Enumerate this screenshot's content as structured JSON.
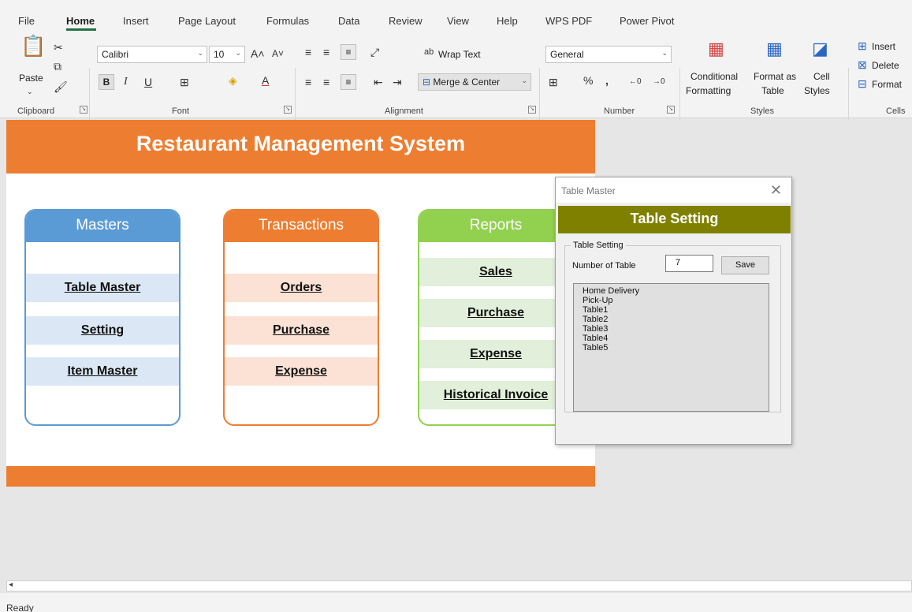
{
  "menu": {
    "tabs": [
      "File",
      "Home",
      "Insert",
      "Page Layout",
      "Formulas",
      "Data",
      "Review",
      "View",
      "Help",
      "WPS PDF",
      "Power Pivot"
    ]
  },
  "ribbon": {
    "clipboard": {
      "paste": "Paste",
      "label": "Clipboard"
    },
    "font": {
      "name": "Calibri",
      "size": "10",
      "label": "Font"
    },
    "alignment": {
      "wrap_text": "Wrap Text",
      "merge_center": "Merge & Center",
      "label": "Alignment"
    },
    "number": {
      "format": "General",
      "label": "Number"
    },
    "styles": {
      "conditional": "Conditional",
      "formatting": "Formatting",
      "format_as": "Format as",
      "table": "Table",
      "cell": "Cell",
      "cell_styles": "Styles",
      "label": "Styles"
    },
    "cells": {
      "insert": "Insert",
      "delete": "Delete",
      "format": "Format",
      "label": "Cells"
    }
  },
  "sheet": {
    "title": "Restaurant Management System",
    "masters": {
      "title": "Masters",
      "items": [
        "Table Master",
        "Setting",
        "Item Master"
      ]
    },
    "transactions": {
      "title": "Transactions",
      "items": [
        "Orders",
        "Purchase",
        "Expense"
      ]
    },
    "reports": {
      "title": "Reports",
      "items": [
        "Sales",
        "Purchase",
        "Expense",
        "Historical Invoice"
      ]
    }
  },
  "dialog": {
    "window_title": "Table Master",
    "header": "Table Setting",
    "frame_label": "Table Setting",
    "number_label": "Number of Table",
    "number_value": "7",
    "save": "Save",
    "list": [
      "Home Delivery",
      "Pick-Up",
      "Table1",
      "Table2",
      "Table3",
      "Table4",
      "Table5"
    ]
  },
  "status": {
    "text": "Ready"
  },
  "colors": {
    "accent_orange": "#ed7d31",
    "masters_blue": "#5b9bd5",
    "reports_green": "#92d050",
    "dialog_header": "#808000",
    "excel_green": "#217346"
  }
}
